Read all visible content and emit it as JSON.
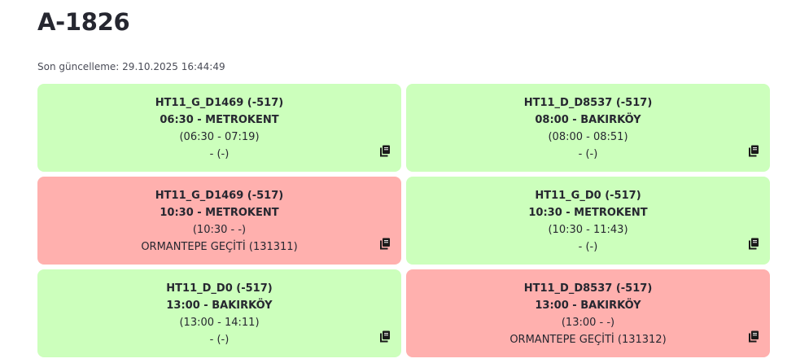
{
  "page": {
    "title": "A-1826",
    "last_updated": "Son güncelleme: 29.10.2025 16:44:49"
  },
  "colors": {
    "on_time": "#ccffbc",
    "late": "#ffb0ae"
  },
  "cards": [
    {
      "status": "on_time",
      "code": "HT11_G_D1469 (-517)",
      "time_dest": "06:30 - METROKENT",
      "window": "(06:30 - 07:19)",
      "stop": "- (-)",
      "icon": "copy-icon"
    },
    {
      "status": "on_time",
      "code": "HT11_D_D8537 (-517)",
      "time_dest": "08:00 - BAKIRKÖY",
      "window": "(08:00 - 08:51)",
      "stop": "- (-)",
      "icon": "copy-icon"
    },
    {
      "status": "late",
      "code": "HT11_G_D1469 (-517)",
      "time_dest": "10:30 - METROKENT",
      "window": "(10:30 - -)",
      "stop": "ORMANTEPE GEÇİTİ (131311)",
      "icon": "copy-icon"
    },
    {
      "status": "on_time",
      "code": "HT11_G_D0 (-517)",
      "time_dest": "10:30 - METROKENT",
      "window": "(10:30 - 11:43)",
      "stop": "- (-)",
      "icon": "copy-icon"
    },
    {
      "status": "on_time",
      "code": "HT11_D_D0 (-517)",
      "time_dest": "13:00 - BAKIRKÖY",
      "window": "(13:00 - 14:11)",
      "stop": "- (-)",
      "icon": "copy-icon"
    },
    {
      "status": "late",
      "code": "HT11_D_D8537 (-517)",
      "time_dest": "13:00 - BAKIRKÖY",
      "window": "(13:00 - -)",
      "stop": "ORMANTEPE GEÇİTİ (131312)",
      "icon": "copy-icon"
    }
  ]
}
